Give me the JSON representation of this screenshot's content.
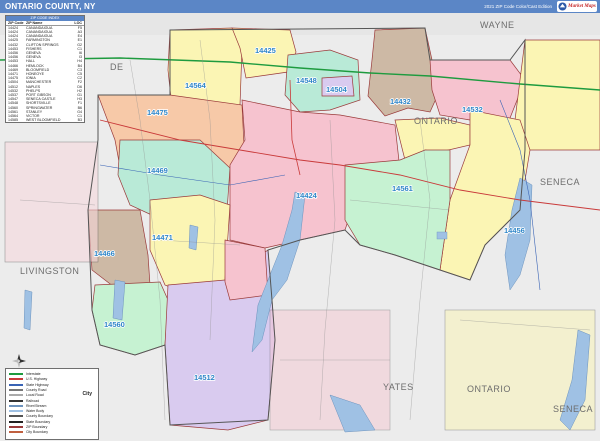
{
  "header": {
    "title": "ONTARIO COUNTY, NY",
    "edition": "2021 ZIP Code Color/Cast Edition",
    "logo_text": "Market Maps",
    "logo_color": "#c62828",
    "bar_color": "#5b86c6"
  },
  "index": {
    "title": "ZIP CODE INDEX",
    "columns": [
      "ZIP Code",
      "ZIP Name",
      "LOC"
    ],
    "rows": [
      [
        "14424",
        "CANANDAIGUA",
        "F5"
      ],
      [
        "14424",
        "CANANDAIGUA",
        "A3"
      ],
      [
        "14424",
        "CANANDAIGUA",
        "E4"
      ],
      [
        "14425",
        "FARMINGTON",
        "E1"
      ],
      [
        "14432",
        "CLIFTON SPRINGS",
        "G2"
      ],
      [
        "14453",
        "FISHERS",
        "C1"
      ],
      [
        "14456",
        "GENEVA",
        "I6"
      ],
      [
        "14456",
        "GENEVA",
        "I3"
      ],
      [
        "14453",
        "HALL",
        "H4"
      ],
      [
        "14466",
        "HEMLOCK",
        "B4"
      ],
      [
        "14469",
        "BLOOMFIELD",
        "C3"
      ],
      [
        "14471",
        "HONEOYE",
        "C5"
      ],
      [
        "14475",
        "IONIA",
        "C2"
      ],
      [
        "14504",
        "MANCHESTER",
        "F2"
      ],
      [
        "14512",
        "NAPLES",
        "D6"
      ],
      [
        "14532",
        "PHELPS",
        "H2"
      ],
      [
        "14537",
        "PORT GIBSON",
        "G1"
      ],
      [
        "14547",
        "SENECA CASTLE",
        "H3"
      ],
      [
        "14548",
        "SHORTSVILLE",
        "F1"
      ],
      [
        "14560",
        "SPRINGWATER",
        "B6"
      ],
      [
        "14561",
        "STANLEY",
        "G4"
      ],
      [
        "14564",
        "VICTOR",
        "C1"
      ],
      [
        "14585",
        "WEST BLOOMFIELD",
        "B3"
      ]
    ]
  },
  "places": [
    "WAYNE",
    "ONTARIO",
    "SENECA",
    "LIVINGSTON",
    "YATES",
    "ONTARIO",
    "SENECA",
    "DE"
  ],
  "zips": [
    "14425",
    "14564",
    "14548",
    "14504",
    "14432",
    "14532",
    "14475",
    "14469",
    "14424",
    "14561",
    "14456",
    "14471",
    "14466",
    "14560",
    "14512"
  ],
  "legend": {
    "items": [
      "Interstate",
      "U.S. Highway",
      "State Highway",
      "County Road",
      "Local Road",
      "Railroad",
      "River/Stream",
      "Water Body",
      "County Boundary",
      "State Boundary",
      "ZIP Boundary",
      "City Boundary"
    ],
    "city_label": "City"
  },
  "colors": {
    "pink": "#f6c3cf",
    "salmon": "#f7c9a8",
    "yellow": "#fbf5b4",
    "green": "#c6f2d2",
    "mint": "#b9ead7",
    "lilac": "#d9cbef",
    "tan": "#cdb9a5",
    "water": "#9fc1e4",
    "outside": "#ececec",
    "zip_label": "#2f86c8"
  }
}
